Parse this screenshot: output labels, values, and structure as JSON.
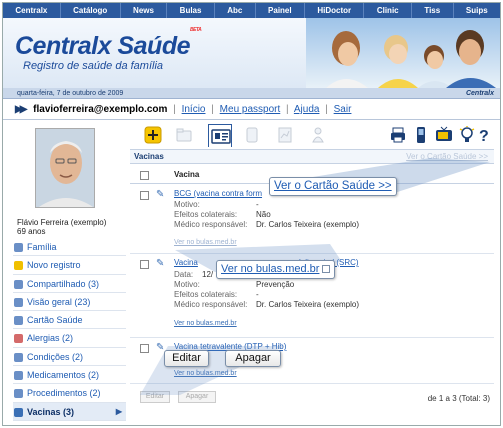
{
  "topnav": [
    "Centralx",
    "Catálogo",
    "News",
    "Bulas",
    "Abc",
    "Painel",
    "HiDoctor",
    "Clinic",
    "Tiss",
    "Suips"
  ],
  "header": {
    "brand": "Centralx Saúde",
    "beta": "BETA",
    "tagline": "Registro de saúde da família",
    "date": "quarta-feira, 7 de outubro de 2009",
    "brand_small": "Centralx"
  },
  "userbar": {
    "email": "flavioferreira@exemplo.com",
    "links": [
      "Início",
      "Meu passport",
      "Ajuda",
      "Sair"
    ]
  },
  "profile": {
    "name": "Flávio Ferreira (exemplo)",
    "age": "69 anos"
  },
  "menu": [
    {
      "label": "Família",
      "color": "#6a8fc6"
    },
    {
      "label": "Novo registro",
      "color": "#f0c000"
    },
    {
      "label": "Compartilhado (3)",
      "color": "#6a8fc6"
    },
    {
      "label": "Visão geral (23)",
      "color": "#6a8fc6"
    },
    {
      "label": "Cartão Saúde",
      "color": "#6a8fc6"
    },
    {
      "label": "Alergias (2)",
      "color": "#d46a6a"
    },
    {
      "label": "Condições (2)",
      "color": "#6a8fc6"
    },
    {
      "label": "Medicamentos (2)",
      "color": "#6a8fc6"
    },
    {
      "label": "Procedimentos (2)",
      "color": "#6a8fc6"
    },
    {
      "label": "Vacinas (3)",
      "color": "#3a6fb5"
    }
  ],
  "main": {
    "section_title": "Vacinas",
    "section_link": "Ver o Cartão Saúde >>",
    "column": "Vacina",
    "records": [
      {
        "title": "BCG (vacina contra form",
        "fields": [
          {
            "k": "Motivo:",
            "v": "-"
          },
          {
            "k": "Efeitos colaterais:",
            "v": "Não"
          },
          {
            "k": "Médico responsável:",
            "v": "Dr. Carlos Teixeira (exemplo)"
          }
        ],
        "bulas": "Ver no bulas.med.br"
      },
      {
        "title": "Vacina",
        "title_tail": "ríplice viral (SRC)",
        "fields": [
          {
            "k": "Data:",
            "v": "12/"
          },
          {
            "k": "Motivo:",
            "v": "Prevenção"
          },
          {
            "k": "Efeitos colaterais:",
            "v": "-"
          },
          {
            "k": "Médico responsável:",
            "v": "Dr. Carlos Teixeira (exemplo)"
          }
        ],
        "bulas": "Ver no bulas.med.br"
      },
      {
        "title": "Vacina tetravalente (DTP + Hib)",
        "bulas": "Ver no bulas.med.br"
      }
    ],
    "btn_edit": "Editar",
    "btn_delete": "Apagar",
    "pager": "de 1 a 3 (Total: 3)"
  },
  "callouts": {
    "cartao": "Ver o Cartão Saúde >>",
    "bulas": "Ver no bulas.med.br",
    "editar": "Editar",
    "apagar": "Apagar"
  }
}
